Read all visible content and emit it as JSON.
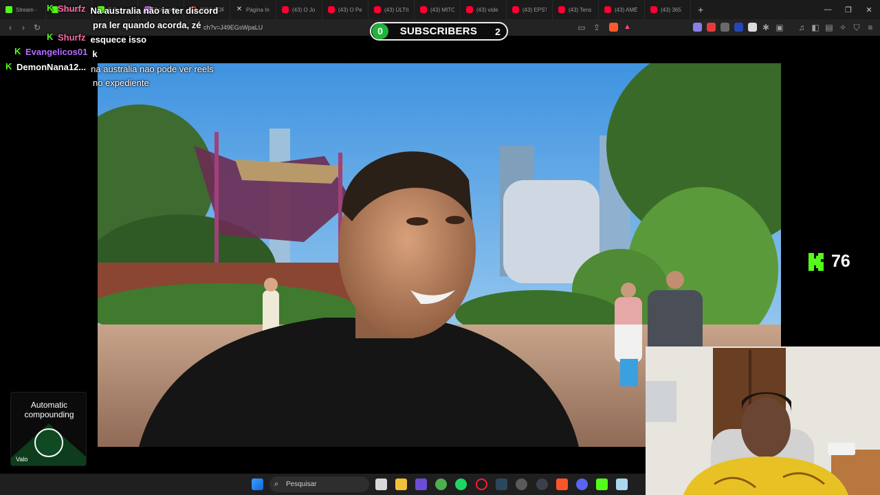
{
  "browser": {
    "tabs": [
      {
        "label": "Stream -",
        "icon": "kick"
      },
      {
        "label": "Stream",
        "icon": "kick"
      },
      {
        "label": "E P",
        "icon": "kick"
      },
      {
        "label": "Screensh",
        "icon": "shot"
      },
      {
        "label": "2016 FOR",
        "icon": "opera"
      },
      {
        "label": "Página In",
        "icon": "x"
      },
      {
        "label": "(43) O Jo",
        "icon": "yt"
      },
      {
        "label": "(43) O Pe",
        "icon": "yt"
      },
      {
        "label": "(43) ÚLTII",
        "icon": "yt"
      },
      {
        "label": "(43) MITC",
        "icon": "yt"
      },
      {
        "label": "(43) víde",
        "icon": "yt"
      },
      {
        "label": "(43) EPST",
        "icon": "yt"
      },
      {
        "label": "(43) Tens",
        "icon": "yt"
      },
      {
        "label": "(43) AMÉ",
        "icon": "yt"
      },
      {
        "label": "(43) 365",
        "icon": "yt"
      }
    ],
    "new_tab": "+",
    "url": "ch?v=J49EGsWpaLU"
  },
  "subscribers": {
    "left_count": "0",
    "label": "SUBSCRIBERS",
    "right_count": "2"
  },
  "chat": [
    {
      "user": "Shurfz",
      "color": "#ff6aa8",
      "message": "Na australia não ia ter discord"
    },
    {
      "user": "",
      "color": "#ffffff",
      "message": "pra ler quando acorda, zé"
    },
    {
      "user": "Shurfz",
      "color": "#ff6aa8",
      "message": "esquece isso"
    },
    {
      "user": "Evangelicos01",
      "color": "#b56cff",
      "message": "k"
    },
    {
      "user": "DemonNana12...",
      "color": "#ffffff",
      "message": "na australia nao pode ver reels"
    },
    {
      "user": "",
      "color": "#ffffff",
      "message": "no expediente"
    }
  ],
  "kick": {
    "viewer_count": "76"
  },
  "ad": {
    "title": "Automatic compounding",
    "brand": "Valo"
  },
  "taskbar": {
    "search_placeholder": "Pesquisar"
  },
  "colors": {
    "kick_green": "#53fc18",
    "subs_green": "#22b33a"
  }
}
